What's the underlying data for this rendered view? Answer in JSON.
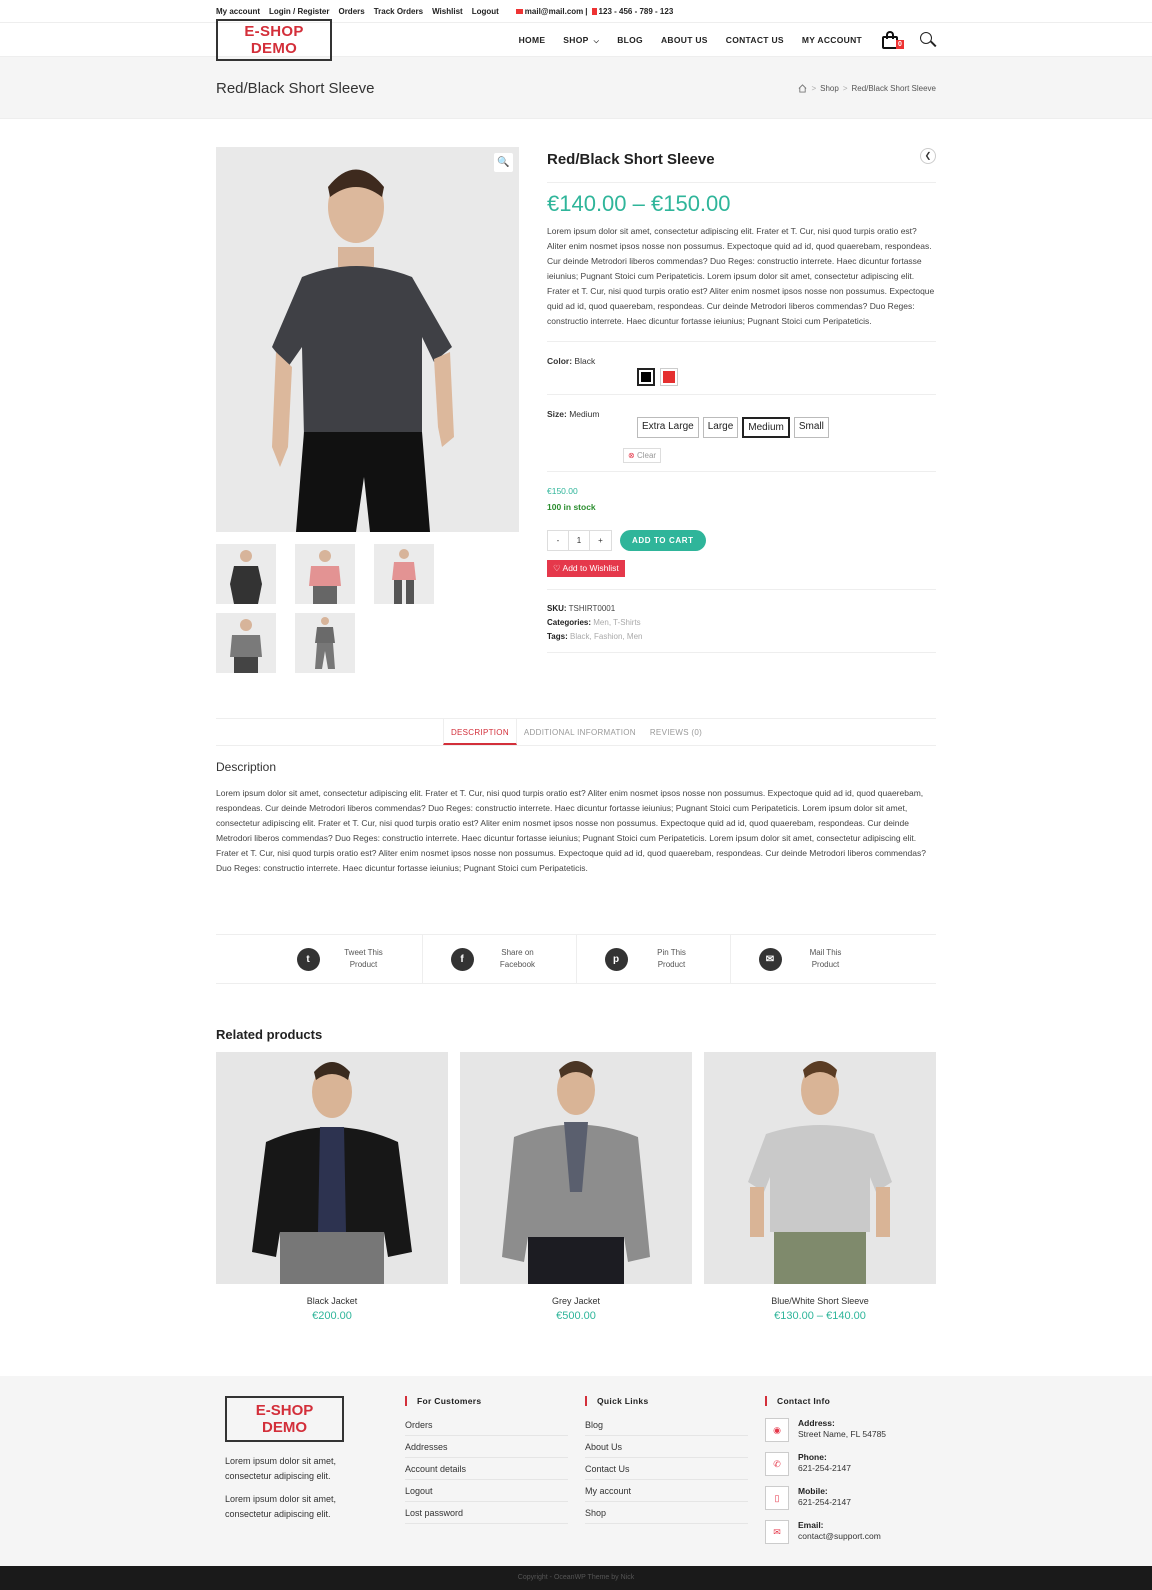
{
  "topbar": {
    "links": [
      "My account",
      "Login / Register",
      "Orders",
      "Track Orders",
      "Wishlist",
      "Logout"
    ],
    "email": "mail@mail.com",
    "phone": "123 - 456 - 789 - 123"
  },
  "header": {
    "logo": "E-SHOP DEMO",
    "nav": [
      "HOME",
      "SHOP",
      "BLOG",
      "ABOUT US",
      "CONTACT US",
      "MY ACCOUNT"
    ],
    "cart_count": "0"
  },
  "page_title": "Red/Black Short Sleeve",
  "breadcrumb": [
    "Shop",
    "Red/Black Short Sleeve"
  ],
  "product": {
    "title": "Red/Black Short Sleeve",
    "price_range": "€140.00 – €150.00",
    "description": "Lorem ipsum dolor sit amet, consectetur adipiscing elit. Frater et T. Cur, nisi quod turpis oratio est? Aliter enim nosmet ipsos nosse non possumus. Expectoque quid ad id, quod quaerebam, respondeas. Cur deinde Metrodori liberos commendas? Duo Reges: constructio interrete. Haec dicuntur fortasse ieiunius; Pugnant Stoici cum Peripateticis. Lorem ipsum dolor sit amet, consectetur adipiscing elit. Frater et T. Cur, nisi quod turpis oratio est? Aliter enim nosmet ipsos nosse non possumus. Expectoque quid ad id, quod quaerebam, respondeas. Cur deinde Metrodori liberos commendas? Duo Reges: constructio interrete. Haec dicuntur fortasse ieiunius; Pugnant Stoici cum Peripateticis.",
    "color_label": "Color:",
    "color_value": "Black",
    "colors": [
      "#000000",
      "#e53030"
    ],
    "size_label": "Size:",
    "size_value": "Medium",
    "sizes": [
      "Extra Large",
      "Large",
      "Medium",
      "Small"
    ],
    "clear_label": "Clear",
    "variation_price": "€150.00",
    "stock": "100 in stock",
    "qty_minus": "-",
    "qty": "1",
    "qty_plus": "+",
    "add_to_cart": "ADD TO CART",
    "wishlist": "Add to Wishlist",
    "sku_label": "SKU:",
    "sku": "TSHIRT0001",
    "categories_label": "Categories:",
    "categories": "Men, T-Shirts",
    "tags_label": "Tags:",
    "tags": "Black, Fashion, Men"
  },
  "tabs": [
    "DESCRIPTION",
    "ADDITIONAL INFORMATION",
    "REVIEWS (0)"
  ],
  "description": {
    "heading": "Description",
    "text": "Lorem ipsum dolor sit amet, consectetur adipiscing elit. Frater et T. Cur, nisi quod turpis oratio est? Aliter enim nosmet ipsos nosse non possumus. Expectoque quid ad id, quod quaerebam, respondeas. Cur deinde Metrodori liberos commendas? Duo Reges: constructio interrete. Haec dicuntur fortasse ieiunius; Pugnant Stoici cum Peripateticis. Lorem ipsum dolor sit amet, consectetur adipiscing elit. Frater et T. Cur, nisi quod turpis oratio est? Aliter enim nosmet ipsos nosse non possumus. Expectoque quid ad id, quod quaerebam, respondeas. Cur deinde Metrodori liberos commendas? Duo Reges: constructio interrete. Haec dicuntur fortasse ieiunius; Pugnant Stoici cum Peripateticis. Lorem ipsum dolor sit amet, consectetur adipiscing elit. Frater et T. Cur, nisi quod turpis oratio est? Aliter enim nosmet ipsos nosse non possumus. Expectoque quid ad id, quod quaerebam, respondeas. Cur deinde Metrodori liberos commendas? Duo Reges: constructio interrete. Haec dicuntur fortasse ieiunius; Pugnant Stoici cum Peripateticis."
  },
  "share": [
    {
      "icon": "twitter-icon",
      "glyph": "t",
      "line1": "Tweet This",
      "line2": "Product"
    },
    {
      "icon": "facebook-icon",
      "glyph": "f",
      "line1": "Share on",
      "line2": "Facebook"
    },
    {
      "icon": "pinterest-icon",
      "glyph": "p",
      "line1": "Pin This",
      "line2": "Product"
    },
    {
      "icon": "mail-icon",
      "glyph": "✉",
      "line1": "Mail This",
      "line2": "Product"
    }
  ],
  "related": {
    "heading": "Related products",
    "items": [
      {
        "name": "Black Jacket",
        "price": "€200.00"
      },
      {
        "name": "Grey Jacket",
        "price": "€500.00"
      },
      {
        "name": "Blue/White Short Sleeve",
        "price": "€130.00 – €140.00"
      }
    ]
  },
  "footer": {
    "logo": "E-SHOP DEMO",
    "text1": "Lorem ipsum dolor sit amet, consectetur adipiscing elit.",
    "text2": "Lorem ipsum dolor sit amet, consectetur adipiscing elit.",
    "customers_heading": "For Customers",
    "customers": [
      "Orders",
      "Addresses",
      "Account details",
      "Logout",
      "Lost password"
    ],
    "quick_heading": "Quick Links",
    "quick": [
      "Blog",
      "About Us",
      "Contact Us",
      "My account",
      "Shop"
    ],
    "contact_heading": "Contact Info",
    "address_label": "Address:",
    "address": "Street Name, FL 54785",
    "phone_label": "Phone:",
    "phone": "621-254-2147",
    "mobile_label": "Mobile:",
    "mobile": "621-254-2147",
    "email_label": "Email:",
    "email": "contact@support.com"
  },
  "copyright": "Copyright - OceanWP Theme by Nick"
}
